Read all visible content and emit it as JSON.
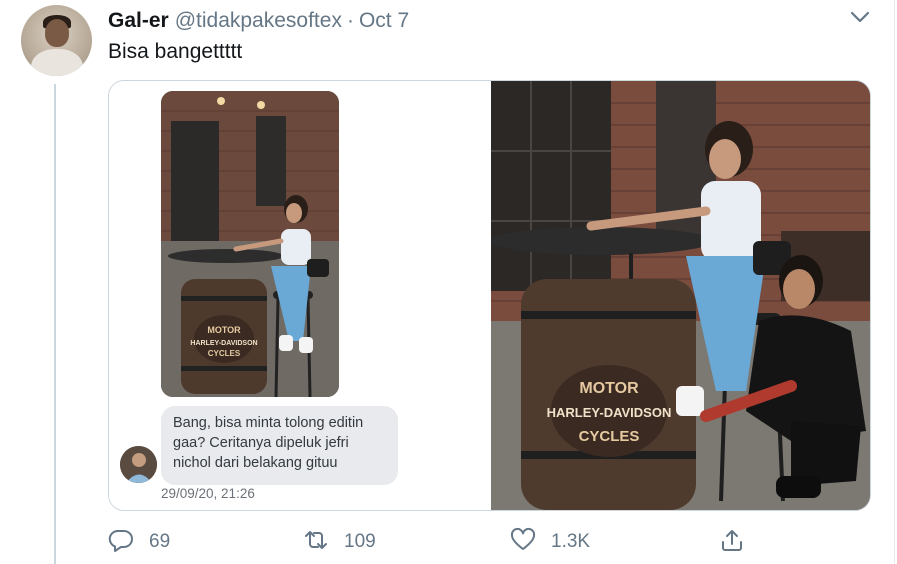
{
  "tweet": {
    "display_name": "Gal-er",
    "handle": "@tidakpakesoftex",
    "separator": "·",
    "date": "Oct 7",
    "text": "Bisa bangettttt"
  },
  "media": {
    "left_panel": {
      "message_lines": [
        "Bang, bisa minta tolong editin",
        "gaa? Ceritanya dipeluk jefri",
        "nichol dari belakang gituu"
      ],
      "timestamp": "29/09/20, 21:26",
      "barrel_text": [
        "MOTOR",
        "HARLEY-DAVIDSON",
        "CYCLES"
      ]
    },
    "right_panel": {
      "barrel_text": [
        "MOTOR",
        "HARLEY-DAVIDSON",
        "CYCLES"
      ]
    }
  },
  "actions": {
    "reply_count": "69",
    "retweet_count": "109",
    "like_count": "1.3K"
  },
  "icons": {
    "caret": "chevron-down-icon",
    "reply": "reply-icon",
    "retweet": "retweet-icon",
    "like": "heart-icon",
    "share": "share-icon"
  },
  "colors": {
    "text_primary": "#14171a",
    "text_secondary": "#657786",
    "border": "#ccd6dd"
  }
}
